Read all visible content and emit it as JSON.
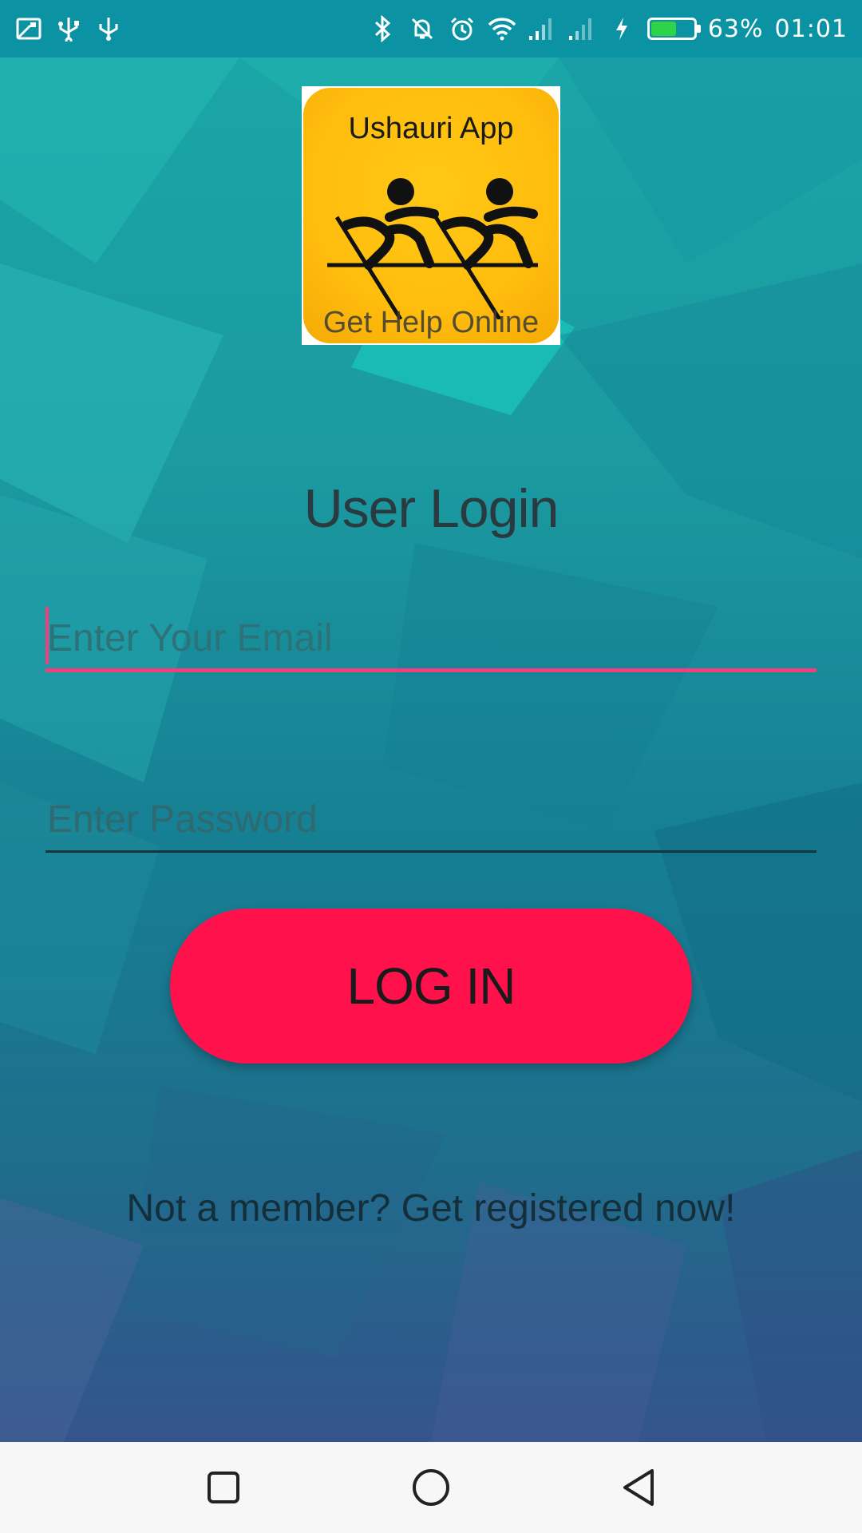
{
  "status_bar": {
    "battery_percent_text": "63%",
    "battery_level": 0.63,
    "time": "01:01",
    "left_icons": [
      "screenshot-icon",
      "usb-icon",
      "usb-icon"
    ],
    "right_icons": [
      "bluetooth-icon",
      "notifications-off-icon",
      "alarm-icon",
      "wifi-icon",
      "signal-icon",
      "signal-icon",
      "charging-icon",
      "battery-icon"
    ]
  },
  "logo": {
    "title": "Ushauri App",
    "subtitle": "Get Help Online"
  },
  "login": {
    "heading": "User Login",
    "email_placeholder": "Enter Your Email",
    "password_placeholder": "Enter Password",
    "button_label": "LOG IN",
    "register_text": "Not a member? Get registered now!"
  },
  "nav_bar": {
    "buttons": [
      "recent-apps",
      "home",
      "back"
    ]
  },
  "colors": {
    "status_bar": "#0c93a3",
    "accent": "#ef3f7c",
    "button": "#ff124c",
    "logo_yellow": "#ffbd0d",
    "nav_bar": "#f7f7f7"
  }
}
